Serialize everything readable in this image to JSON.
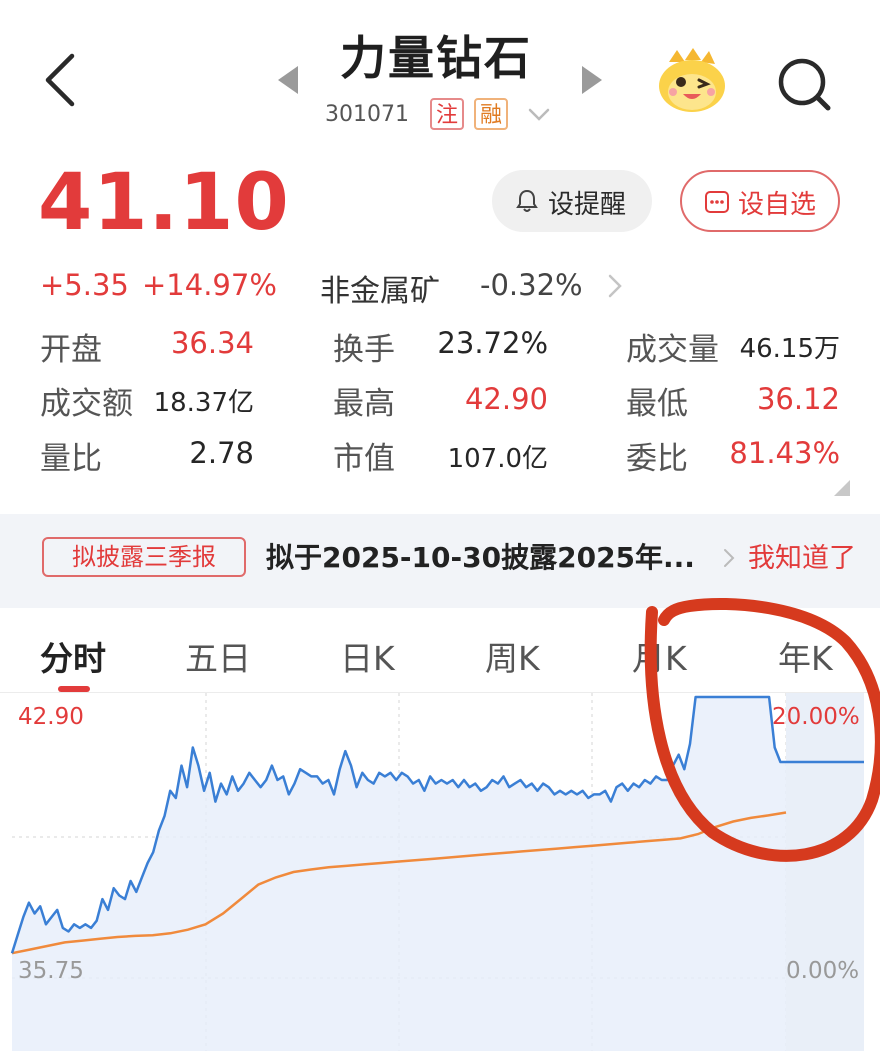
{
  "header": {
    "title": "力量钻石",
    "code": "301071",
    "tag_register": "注",
    "tag_margin": "融"
  },
  "quote": {
    "price": "41.10",
    "change": "+5.35",
    "change_pct": "+14.97%",
    "sector_name": "非金属矿",
    "sector_pct": "-0.32%"
  },
  "actions": {
    "alert_label": "设提醒",
    "watchlist_label": "设自选"
  },
  "stats": [
    {
      "label": "开盘",
      "value": "36.34",
      "color": "#e23b3b"
    },
    {
      "label": "换手",
      "value": "23.72%",
      "color": "#262626"
    },
    {
      "label": "成交量",
      "value": "46.15万",
      "color": "#262626"
    },
    {
      "label": "成交额",
      "value": "18.37亿",
      "color": "#262626"
    },
    {
      "label": "最高",
      "value": "42.90",
      "color": "#e23b3b"
    },
    {
      "label": "最低",
      "value": "36.12",
      "color": "#e23b3b"
    },
    {
      "label": "量比",
      "value": "2.78",
      "color": "#262626"
    },
    {
      "label": "市值",
      "value": "107.0亿",
      "color": "#262626"
    },
    {
      "label": "委比",
      "value": "81.43%",
      "color": "#e23b3b"
    }
  ],
  "banner": {
    "tag": "拟披露三季报",
    "text": "拟于2025-10-30披露2025年...",
    "action": "我知道了"
  },
  "tabs": [
    {
      "label": "分时",
      "active": true
    },
    {
      "label": "五日",
      "active": false
    },
    {
      "label": "日K",
      "active": false
    },
    {
      "label": "周K",
      "active": false
    },
    {
      "label": "月K",
      "active": false
    },
    {
      "label": "年K",
      "active": false
    }
  ],
  "chart_data": {
    "type": "line",
    "y_high_label": "42.90",
    "y_low_label": "35.75",
    "pct_high_label": "20.00%",
    "pct_low_label": "0.00%",
    "ylim": [
      35.75,
      42.9
    ],
    "series": [
      {
        "color": "#3a7fd5",
        "values": [
          35.8,
          36.3,
          36.8,
          37.2,
          36.9,
          37.1,
          36.6,
          36.8,
          37.0,
          36.5,
          36.4,
          36.6,
          36.5,
          36.6,
          36.5,
          36.7,
          37.3,
          37.0,
          37.6,
          37.4,
          37.3,
          37.8,
          37.5,
          37.9,
          38.3,
          38.6,
          39.2,
          39.6,
          40.3,
          40.1,
          41.0,
          40.4,
          41.5,
          41.0,
          40.3,
          40.8,
          40.0,
          40.5,
          40.2,
          40.7,
          40.3,
          40.5,
          40.8,
          40.6,
          40.4,
          40.6,
          41.0,
          40.6,
          40.7,
          40.2,
          40.5,
          40.9,
          40.8,
          40.7,
          40.7,
          40.5,
          40.6,
          40.2,
          40.9,
          41.4,
          41.0,
          40.4,
          40.8,
          40.6,
          40.5,
          40.8,
          40.7,
          40.8,
          40.6,
          40.8,
          40.7,
          40.5,
          40.6,
          40.3,
          40.7,
          40.5,
          40.6,
          40.5,
          40.6,
          40.4,
          40.6,
          40.4,
          40.5,
          40.3,
          40.4,
          40.6,
          40.5,
          40.7,
          40.4,
          40.5,
          40.6,
          40.4,
          40.5,
          40.3,
          40.5,
          40.4,
          40.2,
          40.3,
          40.2,
          40.3,
          40.2,
          40.3,
          40.1,
          40.2,
          40.2,
          40.3,
          40.0,
          40.4,
          40.5,
          40.3,
          40.5,
          40.4,
          40.6,
          40.5,
          40.7,
          40.6,
          40.6,
          41.0,
          41.3,
          40.9,
          41.6,
          42.9,
          42.9,
          42.9,
          42.9,
          42.9,
          42.9,
          42.9,
          42.9,
          42.9,
          42.9,
          42.9,
          42.9,
          42.9,
          42.9,
          41.5,
          41.1,
          41.1
        ]
      },
      {
        "color": "#f08a3c",
        "values": [
          35.8,
          35.9,
          36.0,
          36.1,
          36.15,
          36.2,
          36.25,
          36.28,
          36.3,
          36.35,
          36.45,
          36.6,
          36.9,
          37.3,
          37.7,
          37.9,
          38.05,
          38.12,
          38.18,
          38.22,
          38.26,
          38.3,
          38.34,
          38.38,
          38.42,
          38.46,
          38.5,
          38.54,
          38.58,
          38.62,
          38.66,
          38.7,
          38.74,
          38.78,
          38.82,
          38.86,
          38.9,
          38.94,
          38.98,
          39.1,
          39.3,
          39.45,
          39.55,
          39.62,
          39.7
        ]
      }
    ]
  }
}
